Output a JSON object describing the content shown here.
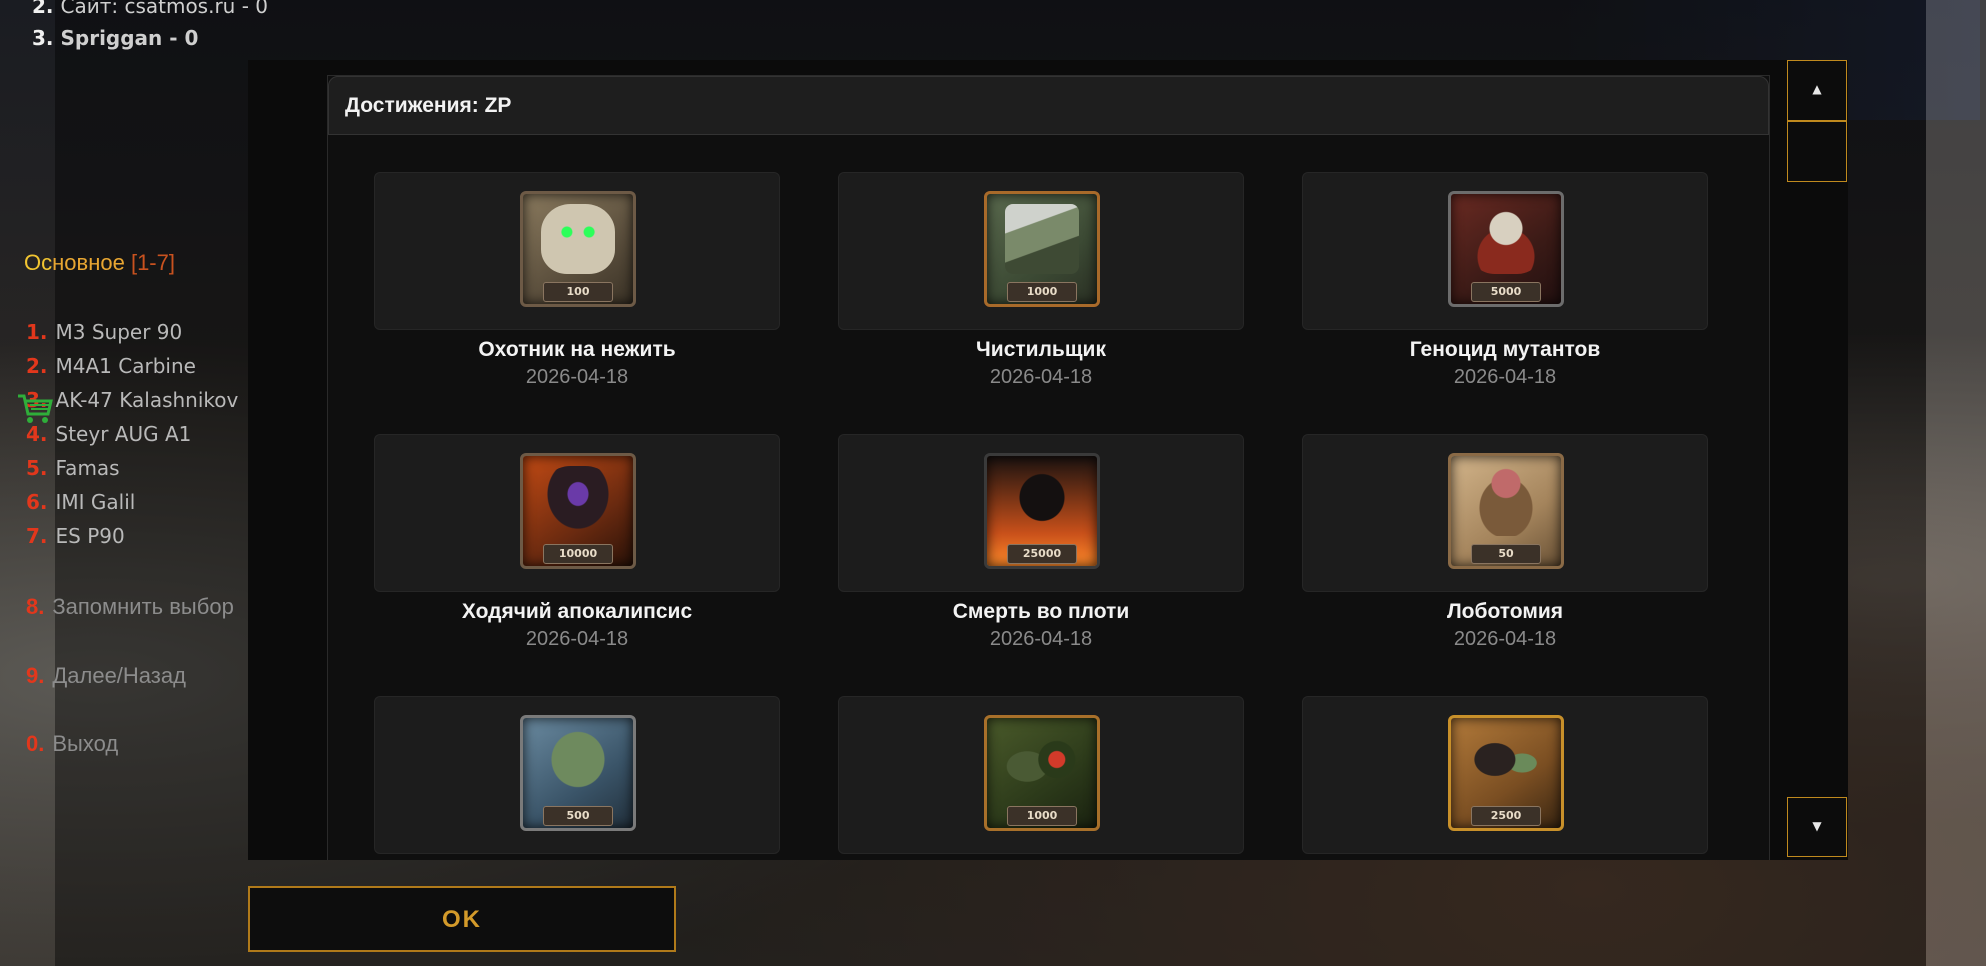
{
  "scoreboard": [
    {
      "num": "2.",
      "text": "Сайт: csatmos.ru - 0"
    },
    {
      "num": "3.",
      "text": "Spriggan - 0"
    }
  ],
  "buy_menu": {
    "title_a": "Ос",
    "title_b": "новное",
    "title_range": "[1-7]",
    "weapons": [
      {
        "num": "1.",
        "name": "M3 Super 90"
      },
      {
        "num": "2.",
        "name": "M4A1 Carbine"
      },
      {
        "num": "3.",
        "name": "AK-47 Kalashnikov"
      },
      {
        "num": "4.",
        "name": "Steyr AUG A1"
      },
      {
        "num": "5.",
        "name": "Famas"
      },
      {
        "num": "6.",
        "name": "IMI Galil"
      },
      {
        "num": "7.",
        "name": "ES P90"
      }
    ],
    "options": [
      {
        "num": "8.",
        "label": "Запомнить выбор"
      },
      {
        "num": "9.",
        "label": "Далее/Назад"
      },
      {
        "num": "0.",
        "label": "Выход"
      }
    ]
  },
  "window": {
    "title": "Достижения: ZP",
    "achievements": [
      {
        "title": "Охотник на нежить",
        "date": "2026-04-18",
        "plate": "100",
        "icon": "skull-icon"
      },
      {
        "title": "Чистильщик",
        "date": "2026-04-18",
        "plate": "1000",
        "icon": "knife-icon"
      },
      {
        "title": "Геноцид мутантов",
        "date": "2026-04-18",
        "plate": "5000",
        "icon": "demon-icon"
      },
      {
        "title": "Ходячий апокалипсис",
        "date": "2026-04-18",
        "plate": "10000",
        "icon": "apocalypse-icon"
      },
      {
        "title": "Смерть во плоти",
        "date": "2026-04-18",
        "plate": "25000",
        "icon": "reaper-icon"
      },
      {
        "title": "Лоботомия",
        "date": "2026-04-18",
        "plate": "50",
        "icon": "lobotomy-icon"
      },
      {
        "title": "",
        "date": "",
        "plate": "500",
        "icon": "surgeon-icon"
      },
      {
        "title": "",
        "date": "",
        "plate": "1000",
        "icon": "sniper-icon"
      },
      {
        "title": "",
        "date": "",
        "plate": "2500",
        "icon": "executioner-icon"
      }
    ]
  },
  "scroll": {
    "up": "▲",
    "down": "▼"
  },
  "ok_label": "OK",
  "colors": {
    "accent": "#b07a1a",
    "menu_number": "#e2371c",
    "menu_title": "#f2c531"
  }
}
